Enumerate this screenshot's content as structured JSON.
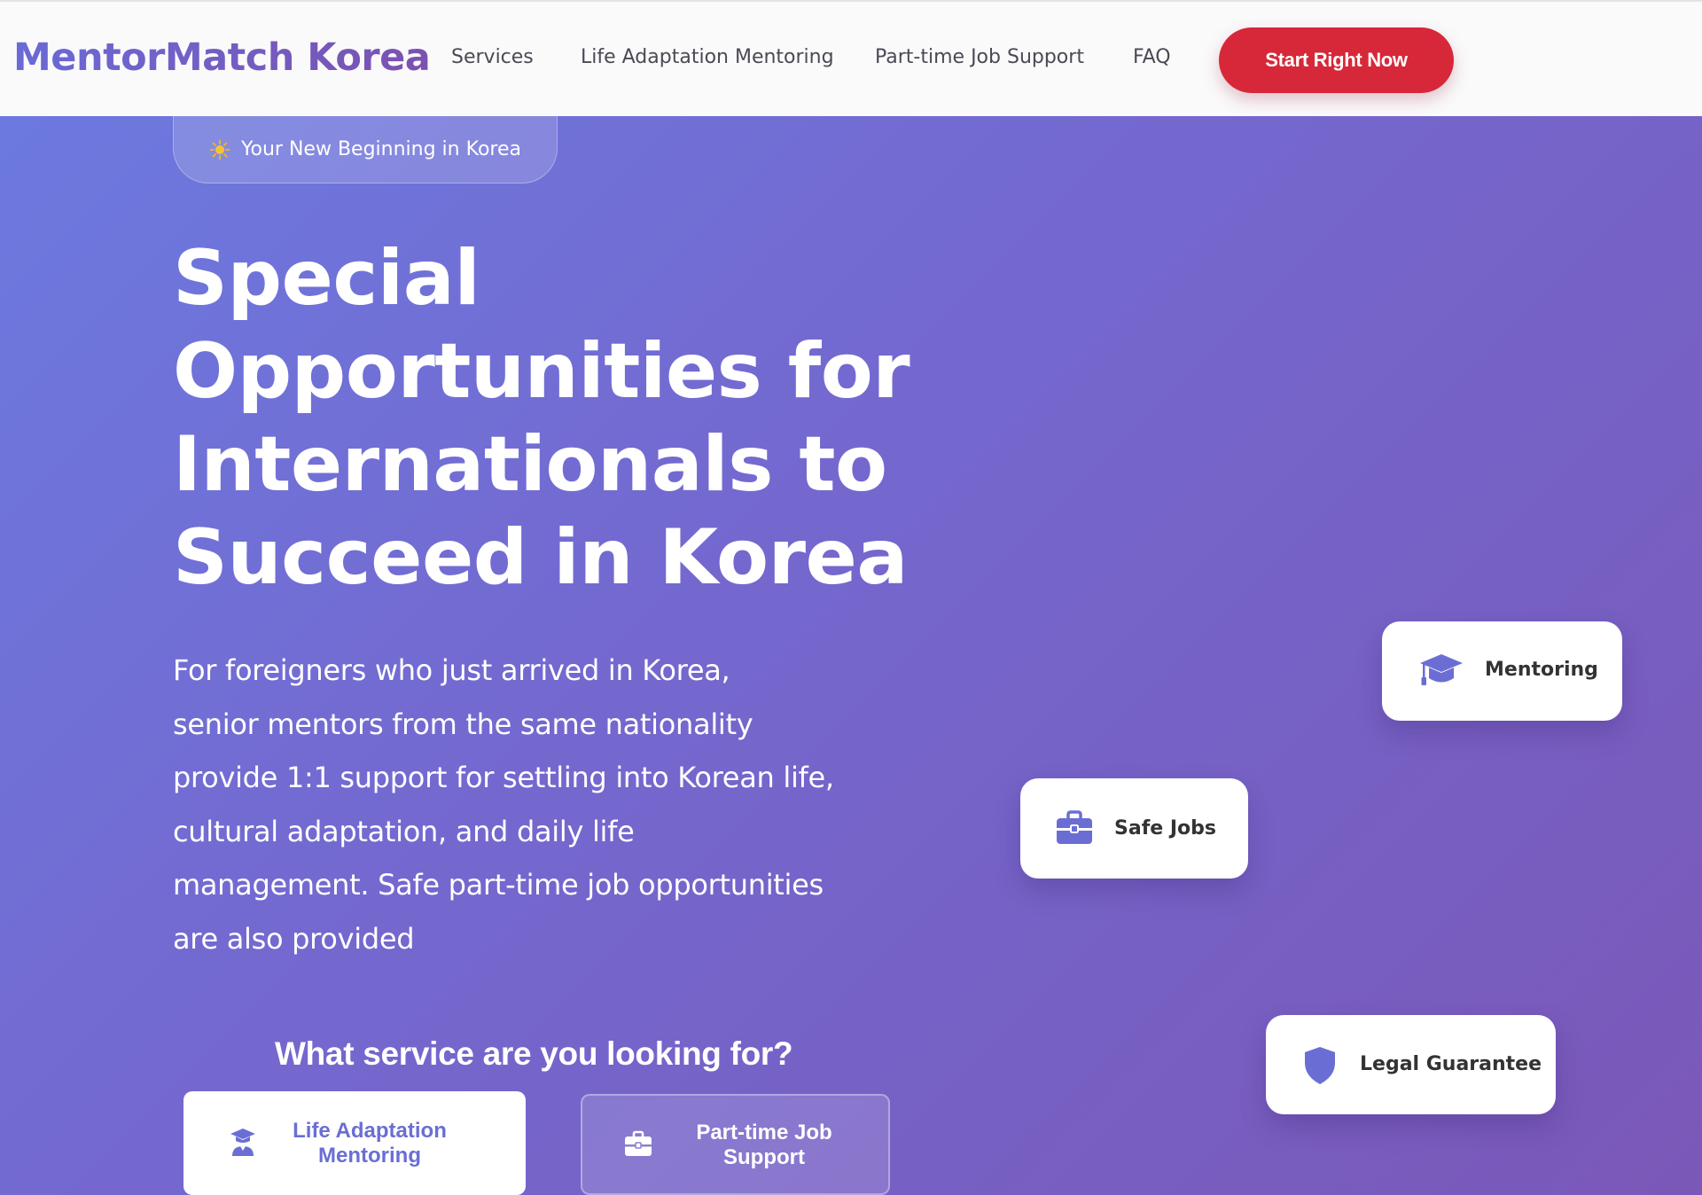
{
  "brand": {
    "name": "MentorMatch Korea"
  },
  "nav": {
    "items": [
      {
        "label": "Services"
      },
      {
        "label": "Life Adaptation Mentoring"
      },
      {
        "label": "Part-time Job Support"
      },
      {
        "label": "FAQ"
      }
    ],
    "cta_label": "Start Right Now"
  },
  "hero": {
    "badge": "Your New Beginning in Korea",
    "badge_icon": "sun-icon",
    "headline_lines": [
      "Special",
      "Opportunities for",
      "Internationals to",
      "Succeed in Korea"
    ],
    "description_lines": [
      "For foreigners who just arrived in Korea,",
      "senior mentors from the same nationality",
      "provide 1:1 support for settling into Korean life,",
      "cultural adaptation, and daily life",
      "management. Safe part-time job opportunities",
      "are also provided"
    ],
    "question": "What service are you looking for?",
    "services": [
      {
        "label_lines": [
          "Life Adaptation",
          "Mentoring"
        ],
        "icon": "graduate-icon",
        "selected": true
      },
      {
        "label_lines": [
          "Part-time Job",
          "Support"
        ],
        "icon": "briefcase-icon",
        "selected": false
      }
    ]
  },
  "cards": [
    {
      "label": "Mentoring",
      "icon": "graduation-cap-icon"
    },
    {
      "label": "Safe Jobs",
      "icon": "briefcase-icon"
    },
    {
      "label": "Legal Guarantee",
      "icon": "shield-icon"
    }
  ],
  "colors": {
    "accent": "#6a6ed4",
    "cta": "#d62839",
    "hero_gradient_start": "#6b7be0",
    "hero_gradient_end": "#7a58b8"
  }
}
